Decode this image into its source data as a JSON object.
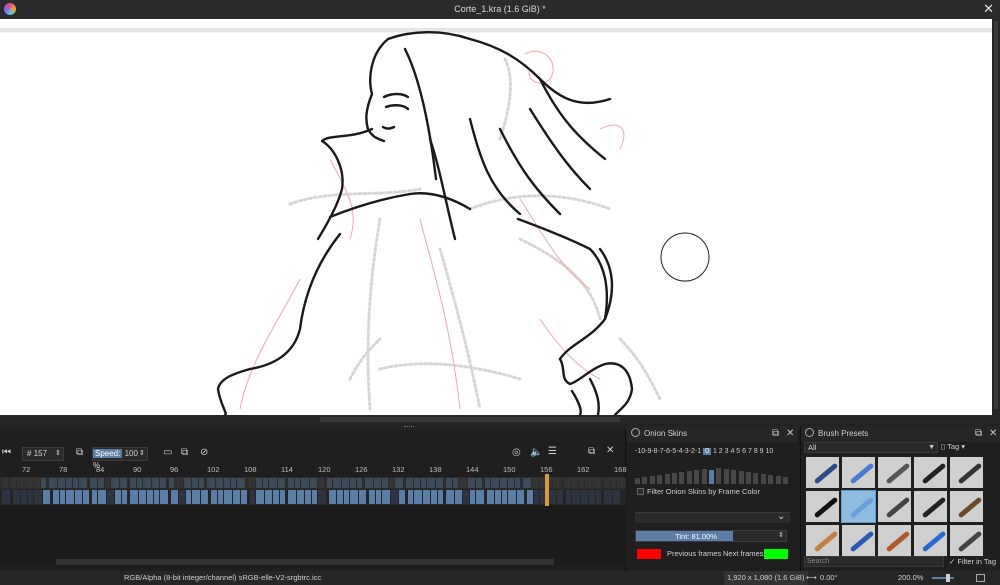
{
  "window": {
    "title": "Corte_1.kra (1.6 GiB) *"
  },
  "timeline": {
    "frame_prefix": "#",
    "frame_value": "157",
    "speed_label": "Speed:",
    "speed_value": "100 %",
    "ruler": [
      "72",
      "78",
      "84",
      "90",
      "96",
      "102",
      "108",
      "114",
      "120",
      "126",
      "132",
      "138",
      "144",
      "150",
      "156",
      "162",
      "168"
    ]
  },
  "onion": {
    "title": "Onion Skins",
    "numbers_prev": "-10-9-8-7-6-5-4-3-2-1",
    "number_current": "0",
    "numbers_next": "1 2 3 4 5 6 7 8 9 10",
    "filter_label": "Filter Onion Skins by Frame Color",
    "tint_label": "Tint: 81.00%",
    "tint_fraction": 0.81,
    "prev_label": "Previous frames",
    "next_label": "Next frames",
    "prev_color": "#ff0000",
    "next_color": "#00ff00"
  },
  "brush": {
    "title": "Brush Presets",
    "tag_select": "All",
    "tag_button": "Tag",
    "search_placeholder": "Search",
    "filter_label": "Filter in Tag"
  },
  "status": {
    "color_space": "RGB/Alpha (8-bit integer/channel)  sRGB-elle-V2-srgbtrc.icc",
    "dimensions": "1,920 x 1,080 (1.6 GiB)",
    "rotation": "0.00°",
    "zoom": "200.0%"
  },
  "colors": {
    "accent": "#5b7ea6",
    "canvas": "#ffffff",
    "panel": "#1f1f1f"
  }
}
